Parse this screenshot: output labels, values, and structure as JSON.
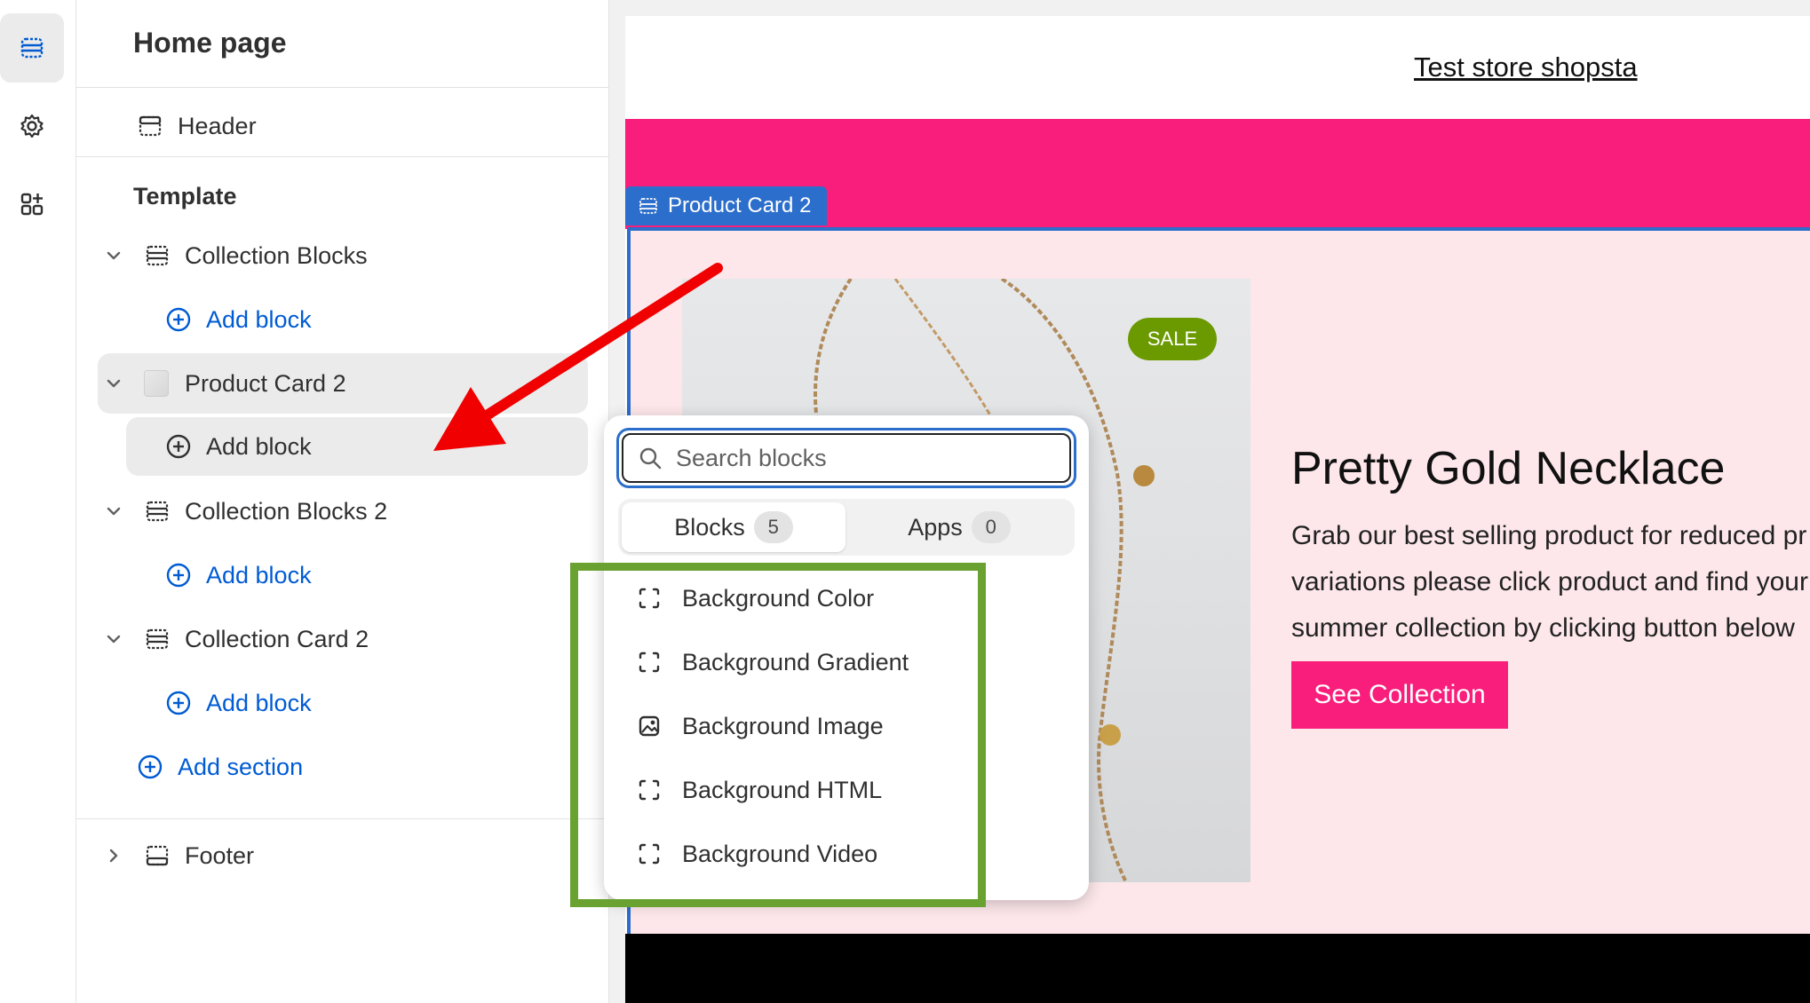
{
  "sidebar": {
    "title": "Home page",
    "header_label": "Header",
    "template_label": "Template",
    "sections": [
      {
        "label": "Collection Blocks",
        "add_label": "Add block"
      },
      {
        "label": "Product Card 2",
        "add_label": "Add block"
      },
      {
        "label": "Collection Blocks 2",
        "add_label": "Add block"
      },
      {
        "label": "Collection Card 2",
        "add_label": "Add block"
      }
    ],
    "add_section_label": "Add section",
    "footer_label": "Footer"
  },
  "preview": {
    "store_title": "Test store shopsta",
    "section_tag": "Product Card 2",
    "sale_badge": "SALE",
    "product_title": "Pretty Gold Necklace",
    "description_lines": [
      "Grab our best selling product for reduced pr",
      "variations please click product and find your",
      "summer collection by clicking button below"
    ],
    "cta_label": "See Collection"
  },
  "popover": {
    "search_placeholder": "Search blocks",
    "tabs": [
      {
        "label": "Blocks",
        "count": "5"
      },
      {
        "label": "Apps",
        "count": "0"
      }
    ],
    "items": [
      {
        "label": "Background Color",
        "icon": "dashed-square-icon"
      },
      {
        "label": "Background Gradient",
        "icon": "dashed-square-icon"
      },
      {
        "label": "Background Image",
        "icon": "image-icon"
      },
      {
        "label": "Background HTML",
        "icon": "dashed-square-icon"
      },
      {
        "label": "Background Video",
        "icon": "dashed-square-icon"
      }
    ]
  },
  "colors": {
    "accent_blue": "#005bd3",
    "selection_blue": "#2c6ecb",
    "brand_pink": "#f91e7c",
    "annotation_red": "#f00000",
    "annotation_green": "#6aa232",
    "sale_green": "#6a9a00"
  }
}
